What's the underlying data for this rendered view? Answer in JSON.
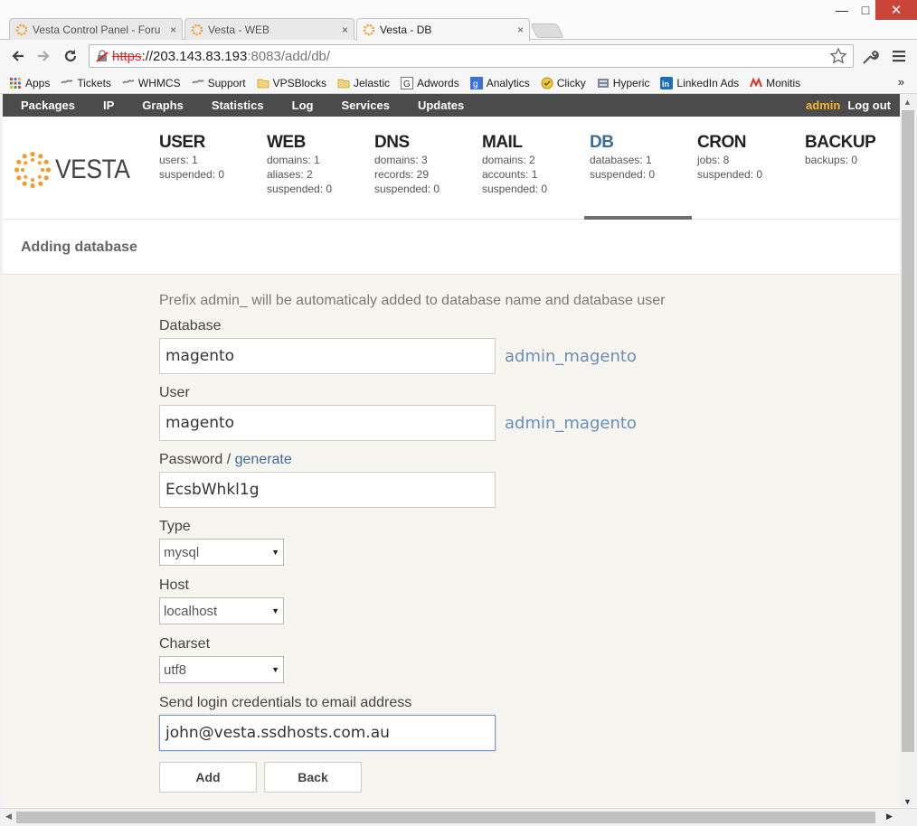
{
  "browser": {
    "tabs": [
      {
        "title": "Vesta Control Panel - Foru",
        "close": "×"
      },
      {
        "title": "Vesta - WEB",
        "close": "×"
      },
      {
        "title": "Vesta - DB",
        "close": "×"
      }
    ],
    "window_buttons": {
      "minimize": "—",
      "maximize": "□",
      "close": "✕"
    },
    "url": {
      "scheme": "https",
      "host": "://203.143.83.193",
      "rest": ":8083/add/db/"
    },
    "bookmarks": [
      "Apps",
      "Tickets",
      "WHMCS",
      "Support",
      "VPSBlocks",
      "Jelastic",
      "Adwords",
      "Analytics",
      "Clicky",
      "Hyperic",
      "LinkedIn Ads",
      "Monitis"
    ],
    "bookmarks_more": "»"
  },
  "nav": {
    "items": [
      "Packages",
      "IP",
      "Graphs",
      "Statistics",
      "Log",
      "Services",
      "Updates"
    ],
    "user": "admin",
    "logout": "Log out"
  },
  "logo": "VESTA",
  "stats": [
    {
      "title": "USER",
      "lines": [
        "users: 1",
        "suspended: 0"
      ]
    },
    {
      "title": "WEB",
      "lines": [
        "domains: 1",
        "aliases: 2",
        "suspended: 0"
      ]
    },
    {
      "title": "DNS",
      "lines": [
        "domains: 3",
        "records: 29",
        "suspended: 0"
      ]
    },
    {
      "title": "MAIL",
      "lines": [
        "domains: 2",
        "accounts: 1",
        "suspended: 0"
      ]
    },
    {
      "title": "DB",
      "lines": [
        "databases: 1",
        "suspended: 0"
      ]
    },
    {
      "title": "CRON",
      "lines": [
        "jobs: 8",
        "suspended: 0"
      ]
    },
    {
      "title": "BACKUP",
      "lines": [
        "backups: 0"
      ]
    }
  ],
  "page_title": "Adding database",
  "form": {
    "hint": "Prefix admin_ will be automaticaly added to database name and database user",
    "database": {
      "label": "Database",
      "value": "magento",
      "prefixed": "admin_magento"
    },
    "user": {
      "label": "User",
      "value": "magento",
      "prefixed": "admin_magento"
    },
    "password": {
      "label": "Password /",
      "generate": "generate",
      "value": "EcsbWhkl1g"
    },
    "type": {
      "label": "Type",
      "value": "mysql"
    },
    "host": {
      "label": "Host",
      "value": "localhost"
    },
    "charset": {
      "label": "Charset",
      "value": "utf8"
    },
    "email": {
      "label": "Send login credentials to email address",
      "value": "john@vesta.ssdhosts.com.au"
    },
    "add": "Add",
    "back": "Back"
  },
  "colors": {
    "accent": "#3d6b99",
    "nav_bg": "#4b4b4b",
    "user": "#f3b52f",
    "logo_orange": "#f39c28"
  }
}
